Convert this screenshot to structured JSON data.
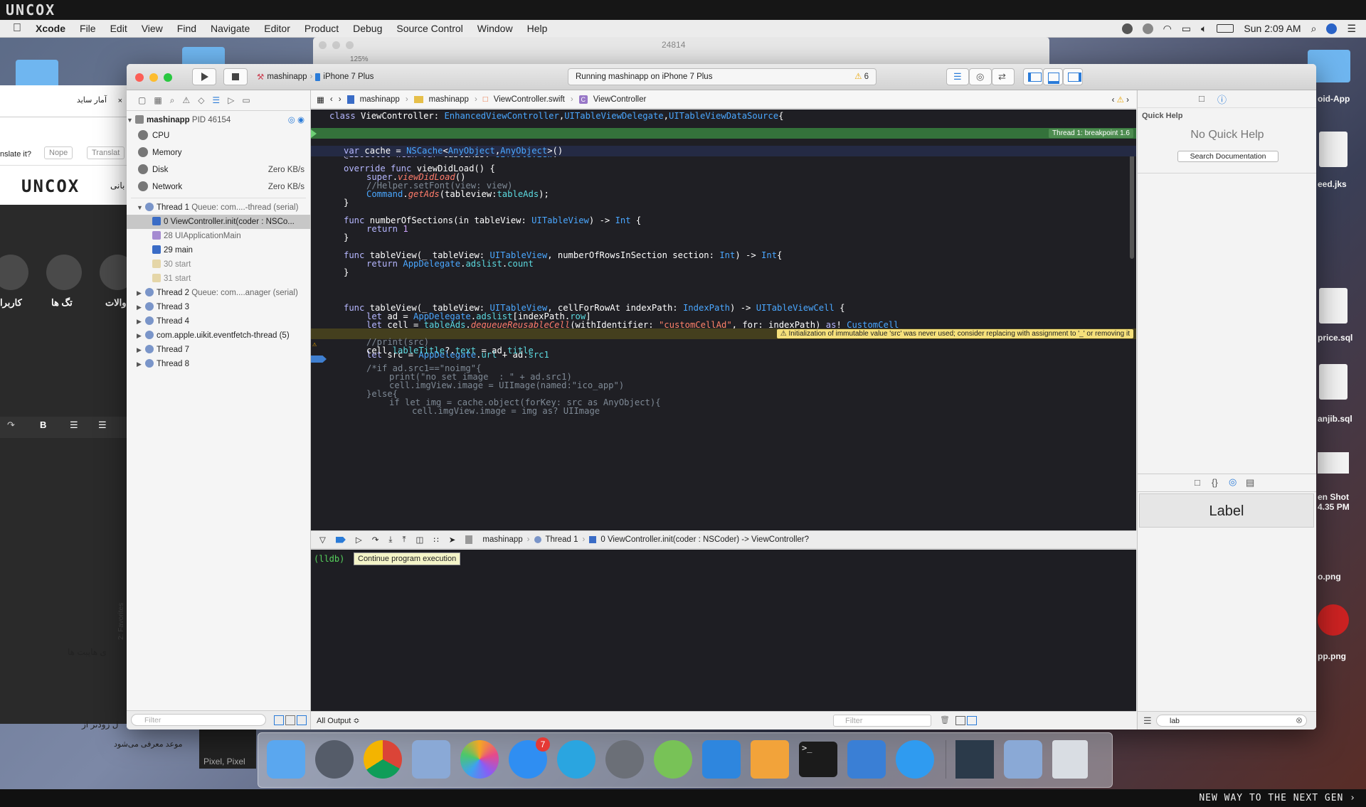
{
  "watermark": {
    "top": "UNCOX",
    "bottom": "NEW WAY TO THE NEXT GEN ›"
  },
  "menubar": {
    "apple": "",
    "app": "Xcode",
    "items": [
      "File",
      "Edit",
      "View",
      "Find",
      "Navigate",
      "Editor",
      "Product",
      "Debug",
      "Source Control",
      "Window",
      "Help"
    ],
    "clock": "Sun 2:09 AM"
  },
  "bg_window": {
    "title": "24814",
    "zoom": "125%"
  },
  "browser": {
    "row1": "آمار ساید",
    "translate_q": "nslate it?",
    "nope": "Nope",
    "translate": "Translat",
    "logo": "UNCOX",
    "logo_side": "بانی",
    "cat_users": "کاربرا",
    "cat_tags": "تگ ها",
    "cat_q": "والات",
    "fav": "2: Favorites",
    "text1": "ی هایبت ها",
    "text2": "ل زودتر از",
    "text3": "موعد معرفی می‌شود",
    "pixel": "Pixel, Pixel"
  },
  "toolbar": {
    "scheme_app": "mashinapp",
    "scheme_device": "iPhone 7 Plus",
    "status": "Running mashinapp on iPhone 7 Plus",
    "warnings": "6"
  },
  "navigator": {
    "process": "mashinapp",
    "pid": "PID 46154",
    "gauges": [
      {
        "label": "CPU",
        "value": ""
      },
      {
        "label": "Memory",
        "value": ""
      },
      {
        "label": "Disk",
        "value": "Zero KB/s"
      },
      {
        "label": "Network",
        "value": "Zero KB/s"
      }
    ],
    "thread1": {
      "name": "Thread 1",
      "queue": "Queue: com....-thread (serial)"
    },
    "frames": [
      "0 ViewController.init(coder : NSCo...",
      "28 UIApplicationMain",
      "29 main",
      "30 start",
      "31 start"
    ],
    "thread2": {
      "name": "Thread 2",
      "queue": "Queue: com....anager (serial)"
    },
    "threads": [
      "Thread 3",
      "Thread 4",
      "com.apple.uikit.eventfetch-thread (5)",
      "Thread 7",
      "Thread 8"
    ],
    "filter_placeholder": "Filter"
  },
  "jumpbar": {
    "crumbs": [
      "mashinapp",
      "mashinapp",
      "ViewController.swift",
      "ViewController"
    ]
  },
  "code": {
    "breakpoint_badge": "Thread 1: breakpoint 1.6",
    "warning_badge": "⚠ Initialization of immutable value 'src' was never used; consider replacing with assignment to '_' or removing it"
  },
  "debugbar": {
    "crumbs": [
      "mashinapp",
      "Thread 1",
      "0 ViewController.init(coder : NSCoder) -> ViewController?"
    ]
  },
  "console": {
    "prompt": "(lldb)",
    "tooltip": "Continue program execution",
    "output_select": "All Output ≎",
    "filter": "Filter"
  },
  "utilities": {
    "title": "Quick Help",
    "no_help": "No Quick Help",
    "search_docs": "Search Documentation",
    "library_item": "Label",
    "search_value": "lab"
  },
  "desktop_files": [
    "oid-App",
    "eed.jks",
    "price.sql",
    "anjib.sql",
    "en Shot",
    "4.35 PM",
    "o.png",
    "pp.png"
  ],
  "dock": {
    "appstore_badge": "7"
  }
}
